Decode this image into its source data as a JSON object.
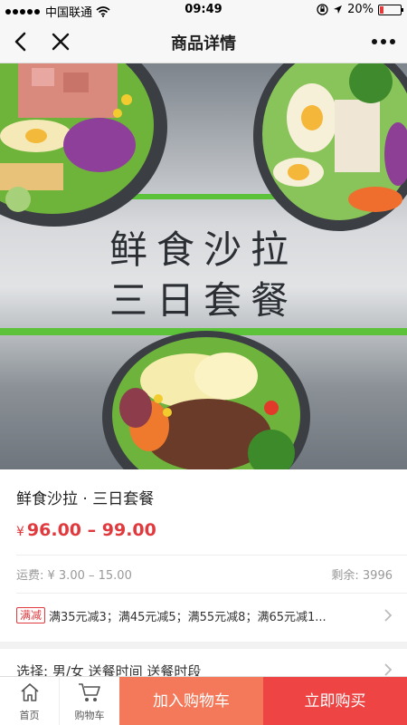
{
  "status_bar": {
    "carrier": "中国联通",
    "time": "09:49",
    "battery": "20%",
    "battery_level": 0.2
  },
  "nav": {
    "title": "商品详情",
    "back_icon": "chevron-left-icon",
    "close_icon": "close-icon",
    "more_icon": "more-horizontal-icon"
  },
  "hero": {
    "line1": "鲜食沙拉",
    "line2": "三日套餐"
  },
  "product": {
    "title": "鲜食沙拉 · 三日套餐",
    "price_symbol": "¥",
    "price_range": "96.00 – 99.00",
    "shipping": "运费: ¥ 3.00 – 15.00",
    "stock": "剩余: 3996"
  },
  "promo": {
    "tag": "满减",
    "text": "满35元减3；满45元减5；满55元减8；满65元减1..."
  },
  "selection": {
    "text": "选择: 男/女 送餐时间 送餐时段"
  },
  "bottom_bar": {
    "home_label": "首页",
    "cart_label": "购物车",
    "add_to_cart": "加入购物车",
    "buy_now": "立即购买"
  },
  "colors": {
    "price": "#e0393e",
    "add_to_cart_bg": "#f4795a",
    "buy_now_bg": "#ee4444",
    "accent_green": "#5cc23a"
  }
}
